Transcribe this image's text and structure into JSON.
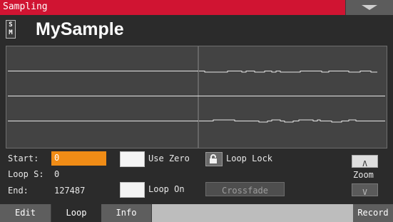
{
  "window": {
    "title": "Sampling",
    "menu_icon": "chevron-down-icon"
  },
  "sample": {
    "badge": "S\nM",
    "name": "MySample"
  },
  "params": {
    "start_label": "Start:",
    "start_value": "0",
    "loop_start_label": "Loop S:",
    "loop_start_value": "0",
    "end_label": "End:",
    "end_value": "127487",
    "use_zero_label": "Use Zero",
    "use_zero_checked": false,
    "loop_lock_label": "Loop Lock",
    "loop_on_label": "Loop On",
    "loop_on_checked": false,
    "crossfade_label": "Crossfade"
  },
  "zoom": {
    "label": "Zoom",
    "in_symbol": "Λ",
    "out_symbol": "V"
  },
  "tabs": [
    {
      "label": "Edit",
      "active": false
    },
    {
      "label": "Loop",
      "active": true
    },
    {
      "label": "Info",
      "active": false
    }
  ],
  "record_label": "Record",
  "colors": {
    "title_bar": "#d01432",
    "accent_field": "#f08c16",
    "background": "#2b2b2b"
  }
}
